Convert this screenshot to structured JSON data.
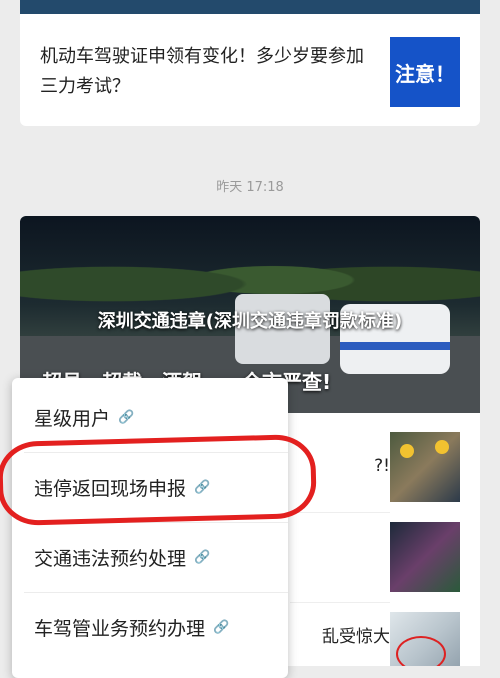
{
  "top_card": {
    "title": "机动车驾驶证申领有变化！多少岁要参加三力考试？",
    "thumb_text": "注意！",
    "accent": "#1553c8"
  },
  "timestamp": "昨天 17:18",
  "hero": {
    "title": "深圳交通违章(深圳交通违章罚款标准)",
    "subtitle": "超员、超载、酒驾……全市严查!"
  },
  "list_items": [
    {
      "title_fragment": "?!"
    },
    {
      "title_fragment": ""
    },
    {
      "title_fragment": "乱受惊大"
    }
  ],
  "menu": {
    "items": [
      {
        "label": "星级用户",
        "icon": "link-icon"
      },
      {
        "label": "违停返回现场申报",
        "icon": "link-icon"
      },
      {
        "label": "交通违法预约处理",
        "icon": "link-icon"
      },
      {
        "label": "车驾管业务预约办理",
        "icon": "link-icon"
      }
    ],
    "highlight_color": "#e3201f"
  }
}
